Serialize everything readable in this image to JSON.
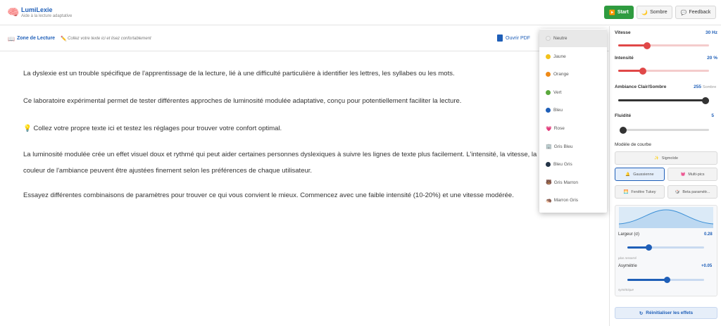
{
  "header": {
    "logo_icon": "🧠",
    "title": "LumiLexie",
    "subtitle": "Aide à la lecture adaptative",
    "start_icon": "▶️",
    "start_label": "Start",
    "theme_icon": "🌙",
    "theme_label": "Sombre",
    "feedback_icon": "💬",
    "feedback_label": "Feedback"
  },
  "zone": {
    "icon": "📖",
    "title": "Zone de Lecture",
    "hint_icon": "✏️",
    "hint": "Collez votre texte ici et lisez confortablement",
    "pdf_label": "Ouvrir PDF"
  },
  "reading": {
    "p1": "La dyslexie est un trouble spécifique de l'apprentissage de la lecture, lié à une difficulté particulière à identifier les lettres, les syllabes ou les mots.",
    "p2": "Ce laboratoire expérimental permet de tester différentes approches de luminosité modulée adaptative, conçu pour potentiellement faciliter la lecture.",
    "p3": "💡 Collez votre propre texte ici et testez les réglages pour trouver votre confort optimal.",
    "p4": "La luminosité modulée crée un effet visuel doux et rythmé qui peut aider certaines personnes dyslexiques à suivre les lignes de texte plus facilement. L'intensité, la vitesse, la couleur de l'ambiance peuvent être ajustées finement selon les préférences de chaque utilisateur.",
    "p5": "Essayez différentes combinaisons de paramètres pour trouver ce qui vous convient le mieux. Commencez avec une faible intensité (10-20%) et une vitesse modérée."
  },
  "dropdown": {
    "items": [
      {
        "label": "Neutre",
        "color": "#ececec"
      },
      {
        "label": "Jaune",
        "color": "#f2c21b"
      },
      {
        "label": "Orange",
        "color": "#ef8a17"
      },
      {
        "label": "Vert",
        "color": "#5aa83c"
      },
      {
        "label": "Bleu",
        "color": "#1f5fb8"
      },
      {
        "label": "Rose",
        "icon": "💗"
      },
      {
        "label": "Gris Bleu",
        "icon": "🏢"
      },
      {
        "label": "Bleu Gris",
        "color": "#243447"
      },
      {
        "label": "Gris Marron",
        "icon": "🐻"
      },
      {
        "label": "Marron Gris",
        "icon": "🦔"
      }
    ],
    "selected_index": 0
  },
  "panel": {
    "vitesse": {
      "label": "Vitesse",
      "value": "30 Hz",
      "level": 0.32
    },
    "intensite": {
      "label": "Intensité",
      "value": "20 %",
      "level": 0.27
    },
    "ambiance": {
      "label": "Ambiance Clair/Sombre",
      "value": "255",
      "value_note": "Sombre",
      "level": 1.0
    },
    "fluidite": {
      "label": "Fluidité",
      "value": "5",
      "level": 0.0
    },
    "curve_model_label": "Modèle de courbe",
    "curves": [
      {
        "label": "Sigmoïde",
        "icon": "✨"
      },
      {
        "label": "Gaussienne",
        "icon": "🔔"
      },
      {
        "label": "Multi-pics",
        "icon": "💓"
      },
      {
        "label": "Fenêtre Tukey",
        "icon": "🌅"
      },
      {
        "label": "Beta paramétr...",
        "icon": "🎲"
      }
    ],
    "active_curve": 1,
    "largeur": {
      "label": "Largeur (σ)",
      "value": "0.28",
      "note": "plus resserré",
      "level": 0.28
    },
    "asymetrie": {
      "label": "Asymétrie",
      "value": "+0.05",
      "note": "symétrique",
      "level": 0.52
    },
    "reset_icon": "↻",
    "reset_label": "Réinitialiser les effets"
  },
  "colors": {
    "accent": "#1f5fb8",
    "start_green": "#2e9b3f",
    "slider_red": "#e04848",
    "slider_blue": "#1f5fb8",
    "slider_dark": "#333333"
  }
}
